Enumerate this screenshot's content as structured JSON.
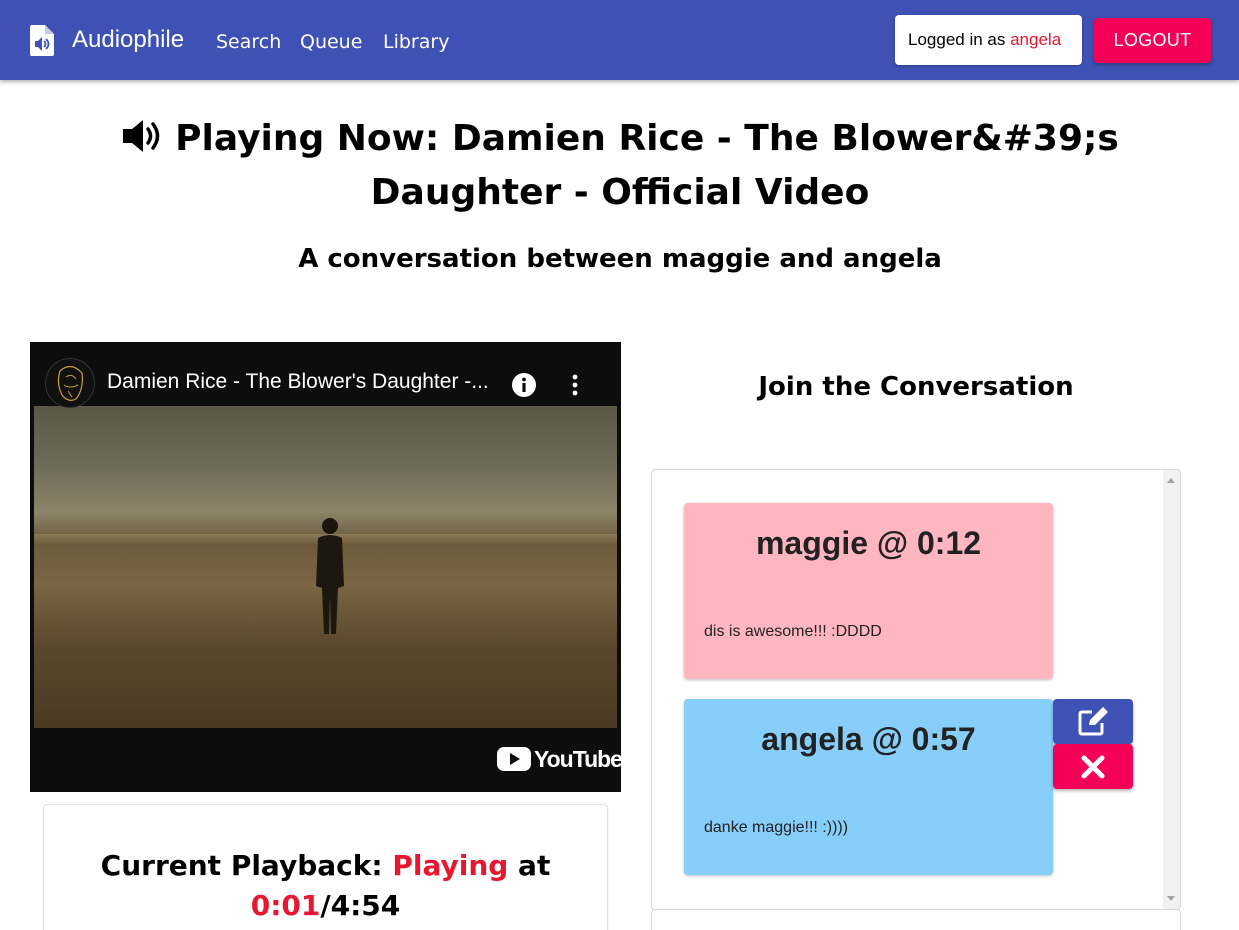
{
  "appbar": {
    "brand": "Audiophile",
    "nav": [
      "Search",
      "Queue",
      "Library"
    ],
    "login_prefix": "Logged in as ",
    "login_user": "angela",
    "logout_label": "LOGOUT"
  },
  "page": {
    "title": "Playing Now: Damien Rice - The Blower&#39;s Daughter - Official Video",
    "subtitle": "A conversation between maggie and angela"
  },
  "video": {
    "title": "Damien Rice - The Blower's Daughter -...",
    "platform": "YouTube"
  },
  "playback": {
    "label": "Current Playback: ",
    "state": "Playing",
    "at": " at",
    "current_time": "0:01",
    "separator": "/",
    "duration": "4:54"
  },
  "conversation": {
    "heading": "Join the Conversation",
    "comments": [
      {
        "header": "maggie @ 0:12",
        "text": "dis is awesome!!! :DDDD",
        "color": "#ffb6c1"
      },
      {
        "header": "angela @ 0:57",
        "text": "danke maggie!!! :))))",
        "color": "#87cefa"
      }
    ]
  },
  "colors": {
    "appbar": "#3f51b5",
    "accent": "#f50057",
    "highlight_text": "#e8172f"
  }
}
